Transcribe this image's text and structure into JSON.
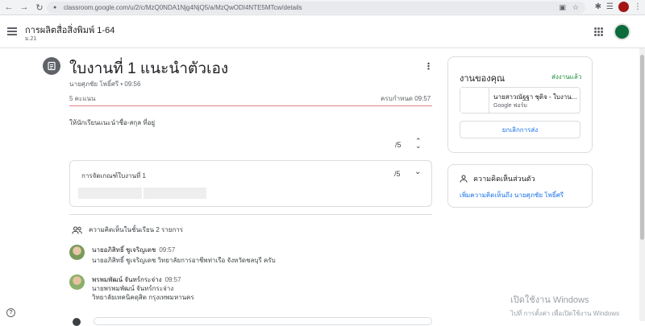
{
  "browser": {
    "url": "classroom.google.com/u/2/c/MzQ0NDA1Njg4NjQ5/a/MzQwODI4NTE5MTcw/details"
  },
  "header": {
    "class_title": "การผลิตสื่อสิ่งพิมพ์ 1-64",
    "class_subtitle": "ม.21"
  },
  "assignment": {
    "title": "ใบงานที่ 1 แนะนำตัวเอง",
    "author_time": "นายศุภชัย โพธิ์ศรี • 09:56",
    "points": "5 คะแนน",
    "due": "ครบกำหนด 09:57",
    "instructions": "ให้นักเรียนแนะนำชื่อ-สกุล ที่อยู่",
    "grade": "/5",
    "rubric": {
      "title": "การจัดเกณฑ์ใบงานที่ 1",
      "grade": "/5"
    }
  },
  "comments": {
    "header": "ความคิดเห็นในชั้นเรียน 2 รายการ",
    "items": [
      {
        "name": "นายอภิสิทธิ์ ชูเจริญเดช",
        "time": "09:57",
        "lines": [
          "นายอภิสิทธิ์ ชูเจริญเดช วิทยาลัยการอาชีพท่าเรือ จังหวัดชลบุรี ครับ"
        ]
      },
      {
        "name": "พรพมพัฒน์ จันทร์กระจ่าง",
        "time": "09:57",
        "lines": [
          "นายพรพมพัฒน์ จันทร์กระจ่าง",
          "วิทยาลัยเทคนิคดุสิต กรุงเทพมหานคร"
        ]
      }
    ]
  },
  "your_work": {
    "title": "งานของคุณ",
    "status": "ส่งงานแล้ว",
    "attachment_name": "นายสาวณัฐฐา ชุติจ - ใบงาน...",
    "attachment_type": "Google ฟอร์ม",
    "unsubmit_label": "ยกเลิกการส่ง"
  },
  "private_comments": {
    "title": "ความคิดเห็นส่วนตัว",
    "add_label": "เพิ่มความคิดเห็นถึง นายศุภชัย โพธิ์ศรี"
  },
  "watermark": {
    "title": "เปิดใช้งาน Windows",
    "subtitle": "ไปที่ การตั้งค่า เพื่อเปิดใช้งาน Windows"
  },
  "colors": {
    "accent": "#1a73e8",
    "turned_in": "#1e8e3e"
  }
}
